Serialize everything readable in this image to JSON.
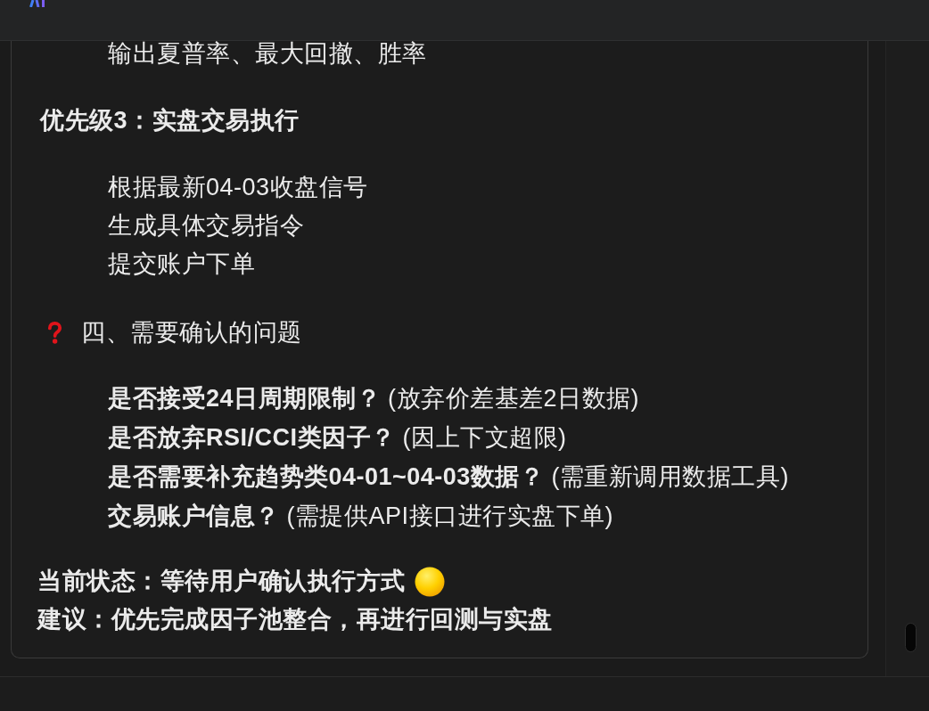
{
  "message": {
    "blocks": [
      {
        "kind": "list",
        "items": [
          "输出夏普率、最大回撤、胜率"
        ]
      },
      {
        "kind": "subheading",
        "text": "优先级3：实盘交易执行"
      },
      {
        "kind": "list",
        "items": [
          "根据最新04-03收盘信号",
          "生成具体交易指令",
          "提交账户下单"
        ]
      },
      {
        "kind": "heading",
        "text": "四、需要确认的问题"
      },
      {
        "kind": "questions",
        "items": [
          "**是否接受24日周期限制？** (放弃价差基差2日数据)",
          "**是否放弃RSI/CCI类因子？** (因上下文超限)",
          "**是否需要补充趋势类04-01~04-03数据？** (需重新调用数据工具)",
          "**交易账户信息？** (需提供API接口进行实盘下单)"
        ]
      },
      {
        "kind": "status",
        "text": "当前状态：等待用户确认执行方式"
      },
      {
        "kind": "note",
        "text": "建议：优先完成因子池整合，再进行回测与实盘"
      }
    ]
  }
}
